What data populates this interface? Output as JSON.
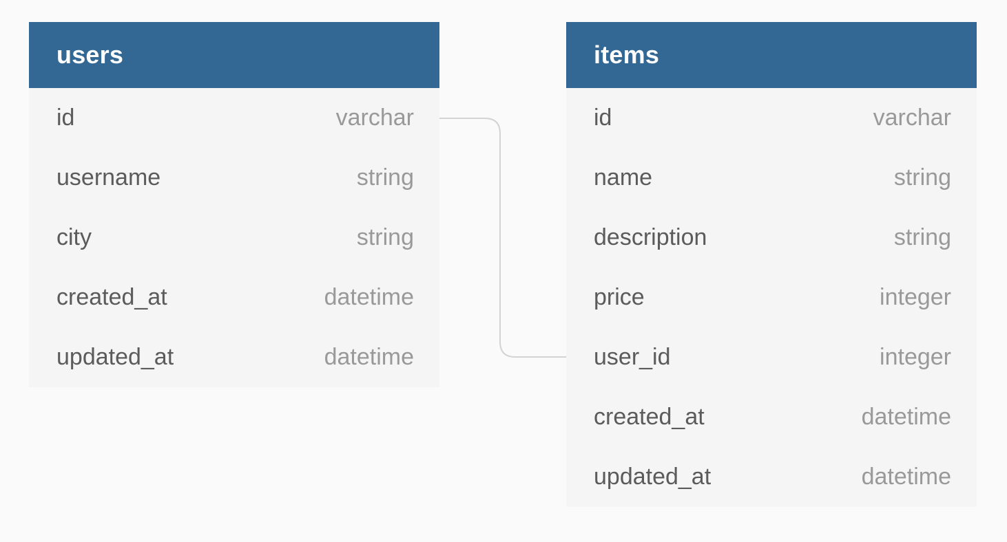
{
  "tables": [
    {
      "title": "users",
      "columns": [
        {
          "name": "id",
          "type": "varchar"
        },
        {
          "name": "username",
          "type": "string"
        },
        {
          "name": "city",
          "type": "string"
        },
        {
          "name": "created_at",
          "type": "datetime"
        },
        {
          "name": "updated_at",
          "type": "datetime"
        }
      ]
    },
    {
      "title": "items",
      "columns": [
        {
          "name": "id",
          "type": "varchar"
        },
        {
          "name": "name",
          "type": "string"
        },
        {
          "name": "description",
          "type": "string"
        },
        {
          "name": "price",
          "type": "integer"
        },
        {
          "name": "user_id",
          "type": "integer"
        },
        {
          "name": "created_at",
          "type": "datetime"
        },
        {
          "name": "updated_at",
          "type": "datetime"
        }
      ]
    }
  ],
  "colors": {
    "header": "#346894",
    "header_text": "#ffffff",
    "table_body": "#f5f5f5",
    "column_name": "#5b5b5b",
    "column_type": "#999999",
    "connector": "#d3d3d3",
    "background": "#fafafa"
  }
}
